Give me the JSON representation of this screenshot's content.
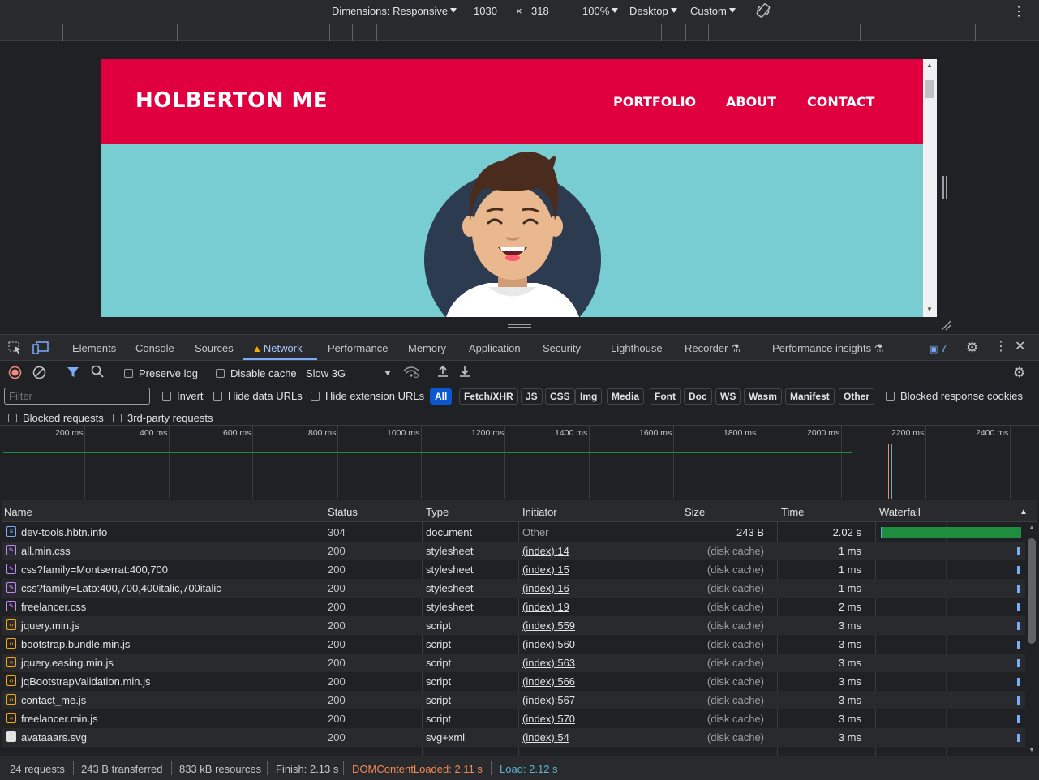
{
  "device_toolbar": {
    "dimensions_label": "Dimensions: Responsive",
    "width": "1030",
    "times": "×",
    "height": "318",
    "zoom": "100%",
    "device_type": "Desktop",
    "throttle": "Custom"
  },
  "site": {
    "brand": "HOLBERTON ME",
    "nav": [
      "PORTFOLIO",
      "ABOUT",
      "CONTACT"
    ]
  },
  "devtools_tabs": {
    "items": [
      "Elements",
      "Console",
      "Sources",
      "Network",
      "Performance",
      "Memory",
      "Application",
      "Security",
      "Lighthouse",
      "Recorder",
      "Performance insights"
    ],
    "active": "Network",
    "issues_count": "7"
  },
  "net_toolbar": {
    "preserve_log": "Preserve log",
    "disable_cache": "Disable cache",
    "throttling": "Slow 3G"
  },
  "filter_row": {
    "placeholder": "Filter",
    "invert": "Invert",
    "hide_data_urls": "Hide data URLs",
    "hide_extension_urls": "Hide extension URLs",
    "types": [
      "All",
      "Fetch/XHR",
      "JS",
      "CSS",
      "Img",
      "Media",
      "Font",
      "Doc",
      "WS",
      "Wasm",
      "Manifest",
      "Other"
    ],
    "active_type": "All",
    "blocked_response_cookies": "Blocked response cookies",
    "blocked_requests": "Blocked requests",
    "third_party": "3rd-party requests"
  },
  "overview_ticks": [
    "200 ms",
    "400 ms",
    "600 ms",
    "800 ms",
    "1000 ms",
    "1200 ms",
    "1400 ms",
    "1600 ms",
    "1800 ms",
    "2000 ms",
    "2200 ms",
    "2400 ms"
  ],
  "table": {
    "headers": {
      "name": "Name",
      "status": "Status",
      "type": "Type",
      "initiator": "Initiator",
      "size": "Size",
      "time": "Time",
      "waterfall": "Waterfall"
    },
    "rows": [
      {
        "name": "dev-tools.hbtn.info",
        "status": "304",
        "type": "document",
        "initiator": "Other",
        "size": "243 B",
        "time": "2.02 s",
        "icon": "doc"
      },
      {
        "name": "all.min.css",
        "status": "200",
        "type": "stylesheet",
        "initiator": "(index):14",
        "size": "(disk cache)",
        "time": "1 ms",
        "icon": "css"
      },
      {
        "name": "css?family=Montserrat:400,700",
        "status": "200",
        "type": "stylesheet",
        "initiator": "(index):15",
        "size": "(disk cache)",
        "time": "1 ms",
        "icon": "css"
      },
      {
        "name": "css?family=Lato:400,700,400italic,700italic",
        "status": "200",
        "type": "stylesheet",
        "initiator": "(index):16",
        "size": "(disk cache)",
        "time": "1 ms",
        "icon": "css"
      },
      {
        "name": "freelancer.css",
        "status": "200",
        "type": "stylesheet",
        "initiator": "(index):19",
        "size": "(disk cache)",
        "time": "2 ms",
        "icon": "css"
      },
      {
        "name": "jquery.min.js",
        "status": "200",
        "type": "script",
        "initiator": "(index):559",
        "size": "(disk cache)",
        "time": "3 ms",
        "icon": "js"
      },
      {
        "name": "bootstrap.bundle.min.js",
        "status": "200",
        "type": "script",
        "initiator": "(index):560",
        "size": "(disk cache)",
        "time": "3 ms",
        "icon": "js"
      },
      {
        "name": "jquery.easing.min.js",
        "status": "200",
        "type": "script",
        "initiator": "(index):563",
        "size": "(disk cache)",
        "time": "3 ms",
        "icon": "js"
      },
      {
        "name": "jqBootstrapValidation.min.js",
        "status": "200",
        "type": "script",
        "initiator": "(index):566",
        "size": "(disk cache)",
        "time": "3 ms",
        "icon": "js"
      },
      {
        "name": "contact_me.js",
        "status": "200",
        "type": "script",
        "initiator": "(index):567",
        "size": "(disk cache)",
        "time": "3 ms",
        "icon": "js"
      },
      {
        "name": "freelancer.min.js",
        "status": "200",
        "type": "script",
        "initiator": "(index):570",
        "size": "(disk cache)",
        "time": "3 ms",
        "icon": "js"
      },
      {
        "name": "avataaars.svg",
        "status": "200",
        "type": "svg+xml",
        "initiator": "(index):54",
        "size": "(disk cache)",
        "time": "3 ms",
        "icon": "img"
      }
    ]
  },
  "status_bar": {
    "requests": "24 requests",
    "transferred": "243 B transferred",
    "resources": "833 kB resources",
    "finish": "Finish: 2.13 s",
    "dom_content_loaded": "DOMContentLoaded: 2.11 s",
    "load": "Load: 2.12 s",
    "dcl_color": "#f28b54",
    "load_color": "#5bb3d0"
  }
}
